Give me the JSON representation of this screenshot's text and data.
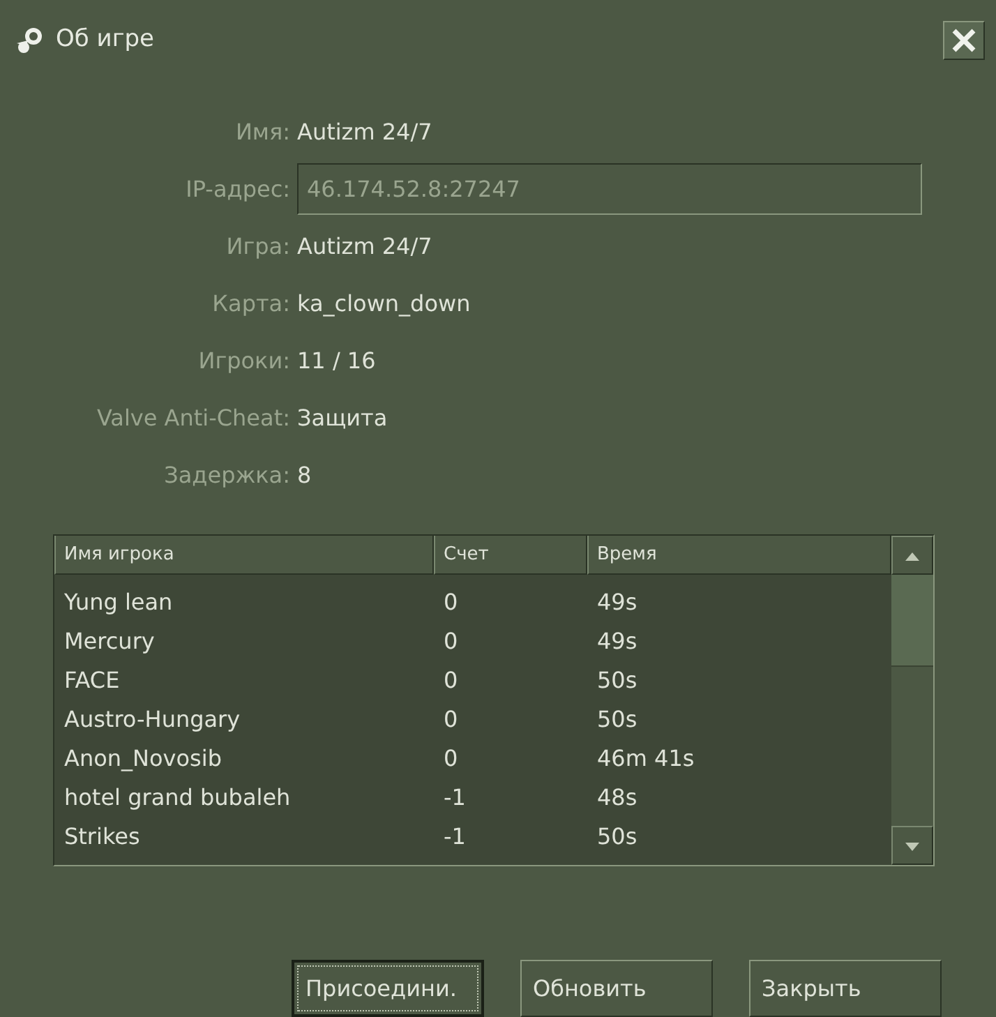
{
  "window": {
    "title": "Об игре"
  },
  "info": [
    {
      "label": "Имя:",
      "value": "Autizm 24/7",
      "kind": "text"
    },
    {
      "label": "IP-адрес:",
      "value": "46.174.52.8:27247",
      "kind": "field"
    },
    {
      "label": "Игра:",
      "value": "Autizm 24/7",
      "kind": "text"
    },
    {
      "label": "Карта:",
      "value": "ka_clown_down",
      "kind": "text"
    },
    {
      "label": "Игроки:",
      "value": "11 / 16",
      "kind": "text"
    },
    {
      "label": "Valve Anti-Cheat:",
      "value": "Защита",
      "kind": "text"
    },
    {
      "label": "Задержка:",
      "value": "8",
      "kind": "text"
    }
  ],
  "table": {
    "columns": [
      "Имя игрока",
      "Счет",
      "Время"
    ],
    "rows": [
      [
        "Yung lean",
        "0",
        "49s"
      ],
      [
        "Mercury",
        "0",
        "49s"
      ],
      [
        "FACE",
        "0",
        "50s"
      ],
      [
        "Austro-Hungary",
        "0",
        "50s"
      ],
      [
        "Anon_Novosib",
        "0",
        "46m 41s"
      ],
      [
        "hotel grand bubaleh",
        "-1",
        "48s"
      ],
      [
        "Strikes",
        "-1",
        "50s"
      ]
    ]
  },
  "buttons": [
    {
      "label": "Присоедини.",
      "focused": true
    },
    {
      "label": "Обновить",
      "focused": false
    },
    {
      "label": "Закрыть",
      "focused": false
    }
  ]
}
